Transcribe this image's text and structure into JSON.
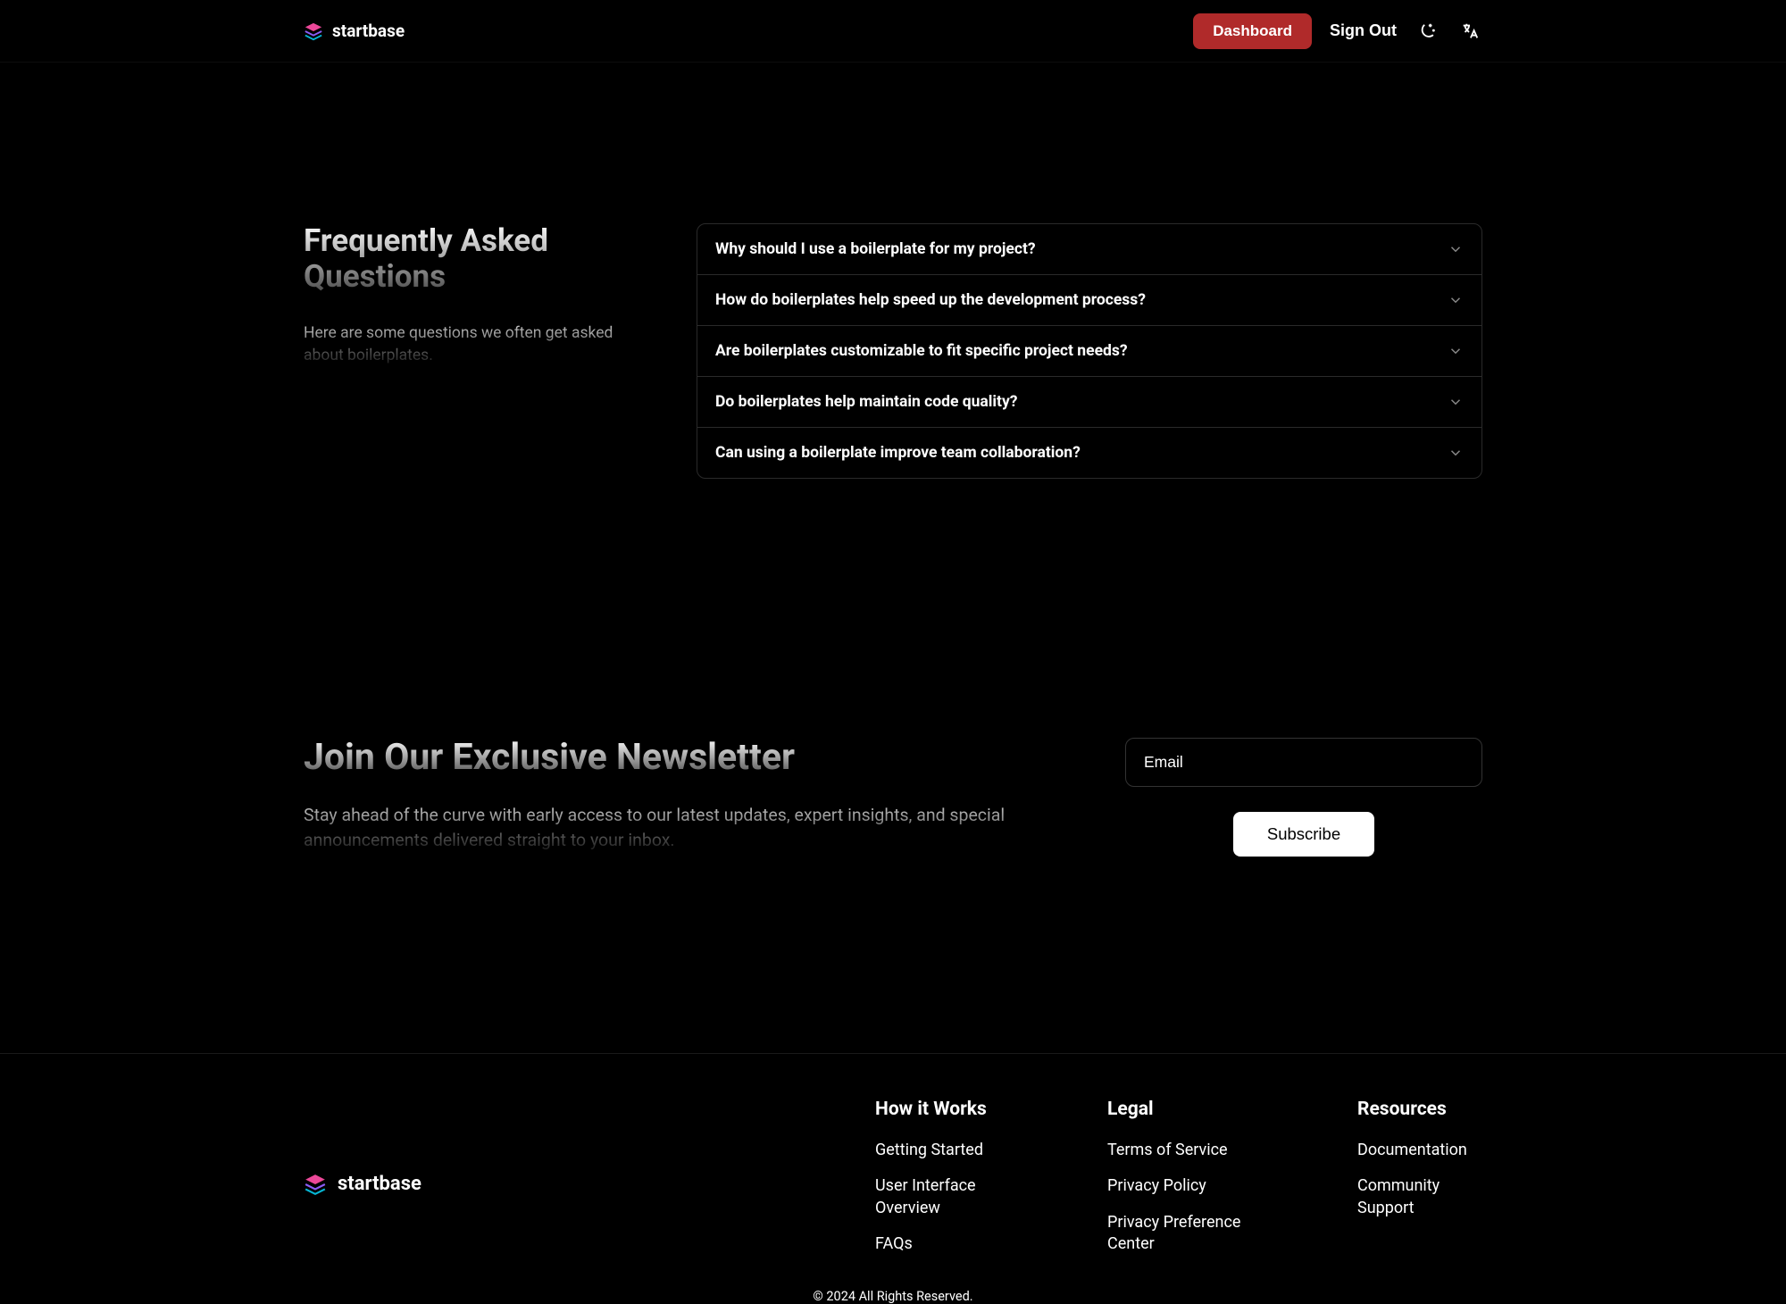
{
  "header": {
    "brand": "startbase",
    "dashboard_label": "Dashboard",
    "signout_label": "Sign Out"
  },
  "faq": {
    "title": "Frequently Asked Questions",
    "subtitle": "Here are some questions we often get asked about boilerplates.",
    "items": [
      "Why should I use a boilerplate for my project?",
      "How do boilerplates help speed up the development process?",
      "Are boilerplates customizable to fit specific project needs?",
      "Do boilerplates help maintain code quality?",
      "Can using a boilerplate improve team collaboration?"
    ]
  },
  "newsletter": {
    "title": "Join Our Exclusive Newsletter",
    "subtitle": "Stay ahead of the curve with early access to our latest updates, expert insights, and special announcements delivered straight to your inbox.",
    "email_placeholder": "Email",
    "subscribe_label": "Subscribe"
  },
  "footer": {
    "brand": "startbase",
    "columns": [
      {
        "title": "How it Works",
        "links": [
          "Getting Started",
          "User Interface Overview",
          "FAQs"
        ]
      },
      {
        "title": "Legal",
        "links": [
          "Terms of Service",
          "Privacy Policy",
          "Privacy Preference Center"
        ]
      },
      {
        "title": "Resources",
        "links": [
          "Documentation",
          "Community Support"
        ]
      }
    ],
    "copyright": "© 2024 All Rights Reserved."
  }
}
